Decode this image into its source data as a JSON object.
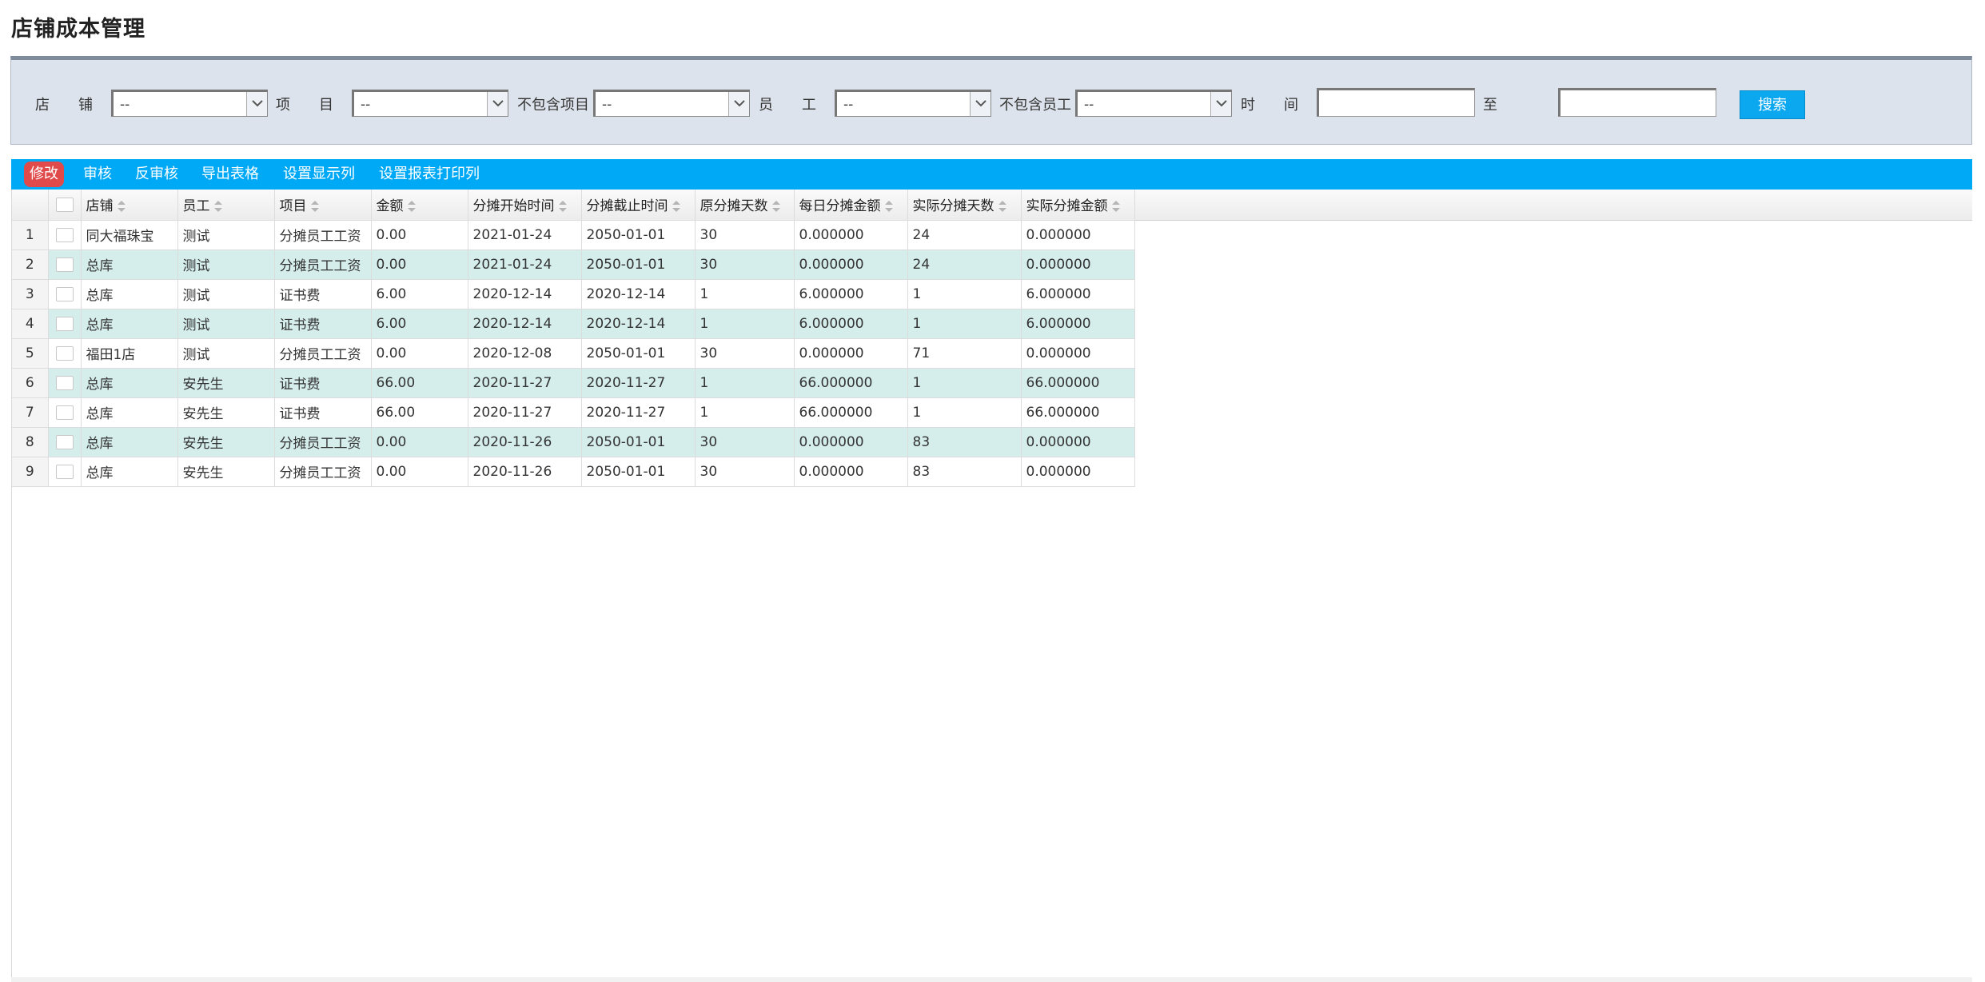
{
  "page": {
    "title": "店铺成本管理"
  },
  "filters": {
    "store": {
      "label": "店　　铺",
      "value": "--"
    },
    "item": {
      "label": "项　　目",
      "value": "--"
    },
    "exclude_item": {
      "label": "不包含项目",
      "value": "--"
    },
    "employee": {
      "label": "员　　工",
      "value": "--"
    },
    "exclude_employee": {
      "label": "不包含员工",
      "value": "--"
    },
    "time": {
      "label": "时　　间",
      "from_value": "",
      "to_label": "至",
      "to_value": ""
    },
    "search_label": "搜索"
  },
  "toolbar": {
    "buttons": [
      {
        "label": "修改",
        "active": true
      },
      {
        "label": "审核"
      },
      {
        "label": "反审核"
      },
      {
        "label": "导出表格"
      },
      {
        "label": "设置显示列"
      },
      {
        "label": "设置报表打印列"
      }
    ]
  },
  "table": {
    "columns": [
      "店铺",
      "员工",
      "项目",
      "金额",
      "分摊开始时间",
      "分摊截止时间",
      "原分摊天数",
      "每日分摊金额",
      "实际分摊天数",
      "实际分摊金额"
    ],
    "rows": [
      {
        "num": "1",
        "cells": [
          "同大福珠宝",
          "测试",
          "分摊员工工资",
          "0.00",
          "2021-01-24",
          "2050-01-01",
          "30",
          "0.000000",
          "24",
          "0.000000"
        ]
      },
      {
        "num": "2",
        "cells": [
          "总库",
          "测试",
          "分摊员工工资",
          "0.00",
          "2021-01-24",
          "2050-01-01",
          "30",
          "0.000000",
          "24",
          "0.000000"
        ]
      },
      {
        "num": "3",
        "cells": [
          "总库",
          "测试",
          "证书费",
          "6.00",
          "2020-12-14",
          "2020-12-14",
          "1",
          "6.000000",
          "1",
          "6.000000"
        ]
      },
      {
        "num": "4",
        "cells": [
          "总库",
          "测试",
          "证书费",
          "6.00",
          "2020-12-14",
          "2020-12-14",
          "1",
          "6.000000",
          "1",
          "6.000000"
        ]
      },
      {
        "num": "5",
        "cells": [
          "福田1店",
          "测试",
          "分摊员工工资",
          "0.00",
          "2020-12-08",
          "2050-01-01",
          "30",
          "0.000000",
          "71",
          "0.000000"
        ]
      },
      {
        "num": "6",
        "cells": [
          "总库",
          "安先生",
          "证书费",
          "66.00",
          "2020-11-27",
          "2020-11-27",
          "1",
          "66.000000",
          "1",
          "66.000000"
        ]
      },
      {
        "num": "7",
        "cells": [
          "总库",
          "安先生",
          "证书费",
          "66.00",
          "2020-11-27",
          "2020-11-27",
          "1",
          "66.000000",
          "1",
          "66.000000"
        ]
      },
      {
        "num": "8",
        "cells": [
          "总库",
          "安先生",
          "分摊员工工资",
          "0.00",
          "2020-11-26",
          "2050-01-01",
          "30",
          "0.000000",
          "83",
          "0.000000"
        ]
      },
      {
        "num": "9",
        "cells": [
          "总库",
          "安先生",
          "分摊员工工资",
          "0.00",
          "2020-11-26",
          "2050-01-01",
          "30",
          "0.000000",
          "83",
          "0.000000"
        ]
      }
    ]
  },
  "colors": {
    "toolbar": "#00a9f5",
    "active_button": "#e04a4a",
    "alt_row": "#d5eeec",
    "filter_panel": "#dde3ec"
  }
}
